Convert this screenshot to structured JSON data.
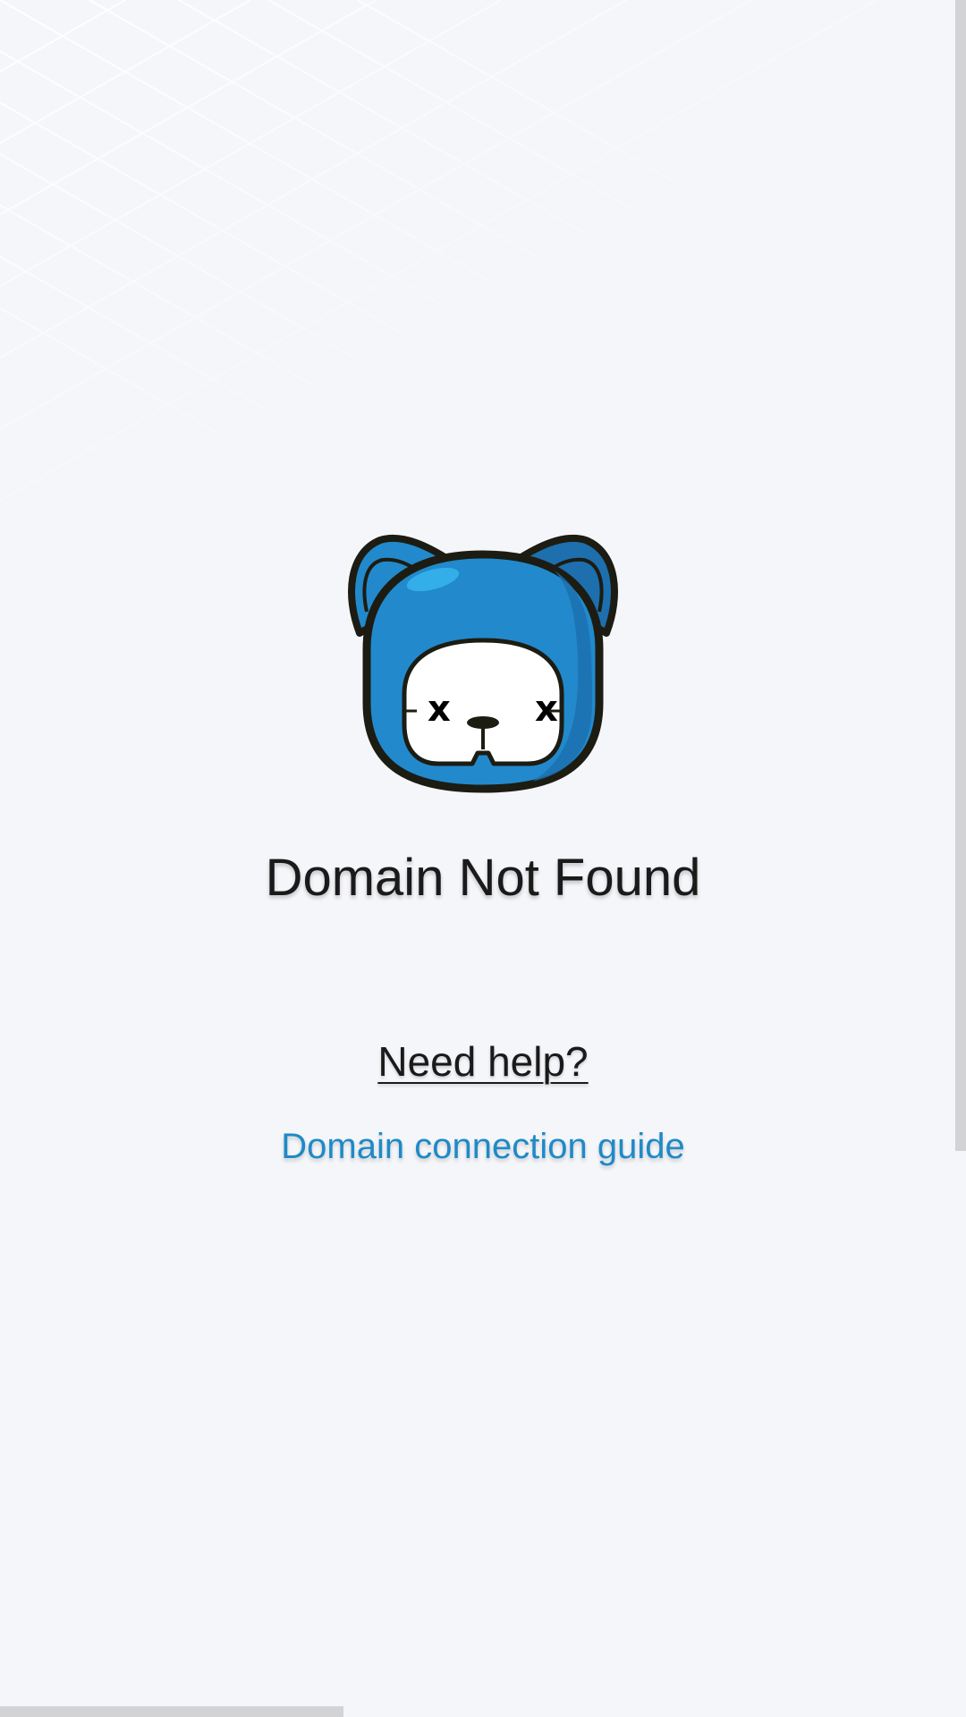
{
  "page": {
    "title": "Domain Not Found",
    "help_label": "Need help?",
    "guide_link": "Domain connection guide"
  },
  "icons": {
    "mascot": "blue-cat-mascot-icon",
    "mascot_eyes": "x"
  },
  "colors": {
    "background": "#f5f6fa",
    "mascot_blue": "#2289cc",
    "link": "#1f8ac6",
    "text": "#1a1a1a"
  }
}
